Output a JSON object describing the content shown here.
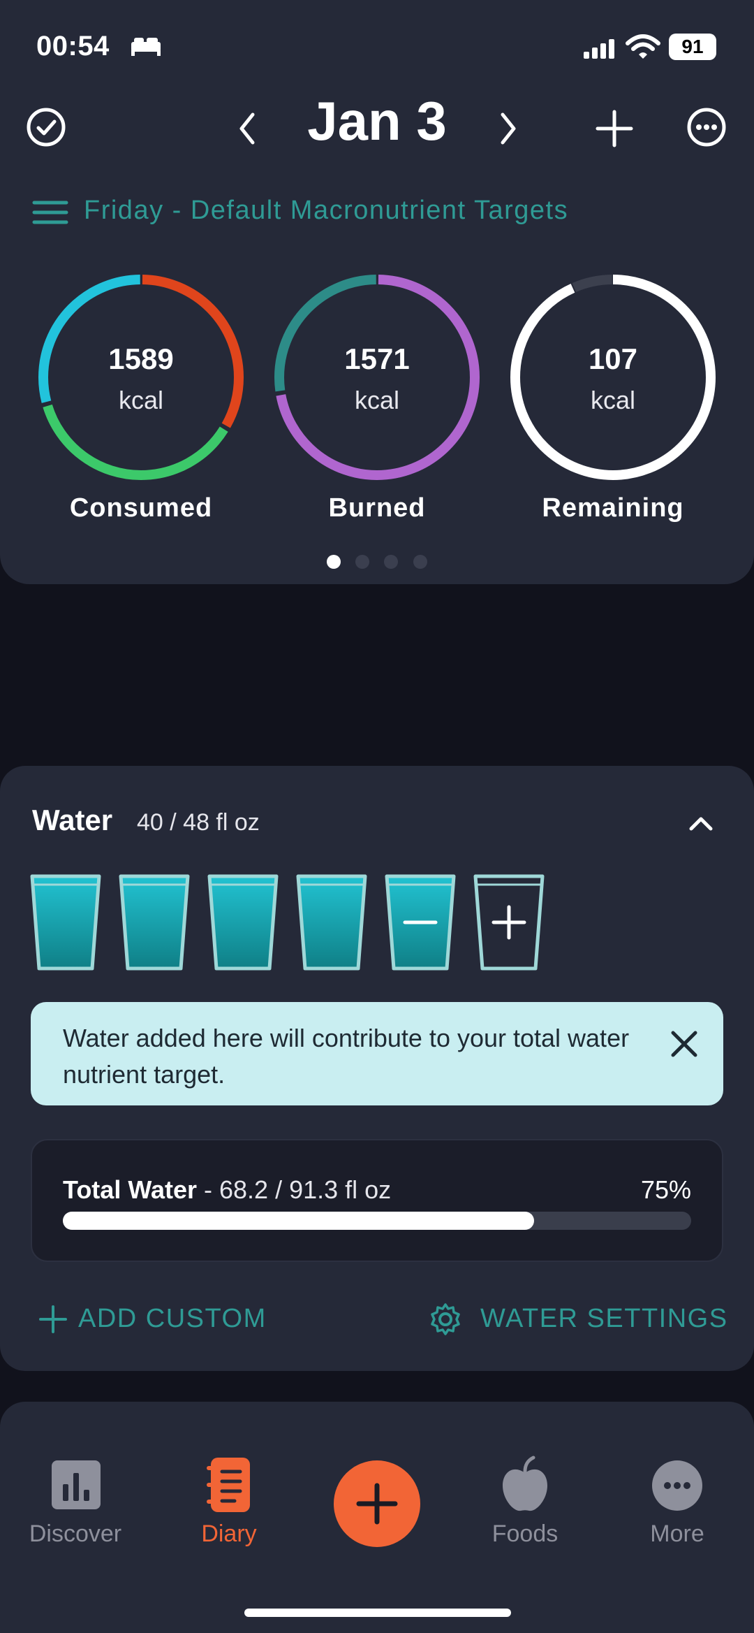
{
  "status_bar": {
    "time": "00:54",
    "battery": "91"
  },
  "header": {
    "date": "Jan 3",
    "subtitle": "Friday - Default Macronutrient Targets",
    "icons": [
      "check-circle-icon",
      "chevron-left-icon",
      "chevron-right-icon",
      "plus-icon",
      "more-icon",
      "menu-icon"
    ]
  },
  "rings": [
    {
      "value": "1589",
      "unit": "kcal",
      "label": "Consumed"
    },
    {
      "value": "1571",
      "unit": "kcal",
      "label": "Burned"
    },
    {
      "value": "107",
      "unit": "kcal",
      "label": "Remaining"
    }
  ],
  "pager": {
    "pages": 4,
    "active": 1
  },
  "water": {
    "title": "Water",
    "amount": "40 / 48 fl oz",
    "glasses_filled": 5,
    "info_text": "Water added here will contribute to your total water nutrient target.",
    "total_label": "Total Water",
    "total_value": " - 68.2 / 91.3 fl oz",
    "total_percent": "75%",
    "total_fraction": 0.75,
    "add_custom": "ADD CUSTOM",
    "water_settings": "WATER SETTINGS"
  },
  "nav": {
    "items": [
      {
        "label": "Discover",
        "icon": "chart-icon"
      },
      {
        "label": "Diary",
        "icon": "notebook-icon"
      },
      {
        "label": "Foods",
        "icon": "apple-icon"
      },
      {
        "label": "More",
        "icon": "more-icon"
      }
    ],
    "active": "Diary"
  },
  "colors": {
    "accent": "#2f9b95",
    "orange": "#f26536",
    "consumed_blue": "#22c3dc",
    "consumed_red": "#e0451c",
    "consumed_green": "#3cc96a",
    "burned_teal": "#2d8c88",
    "burned_purple": "#b066cf",
    "water": "#1aa6b3"
  }
}
